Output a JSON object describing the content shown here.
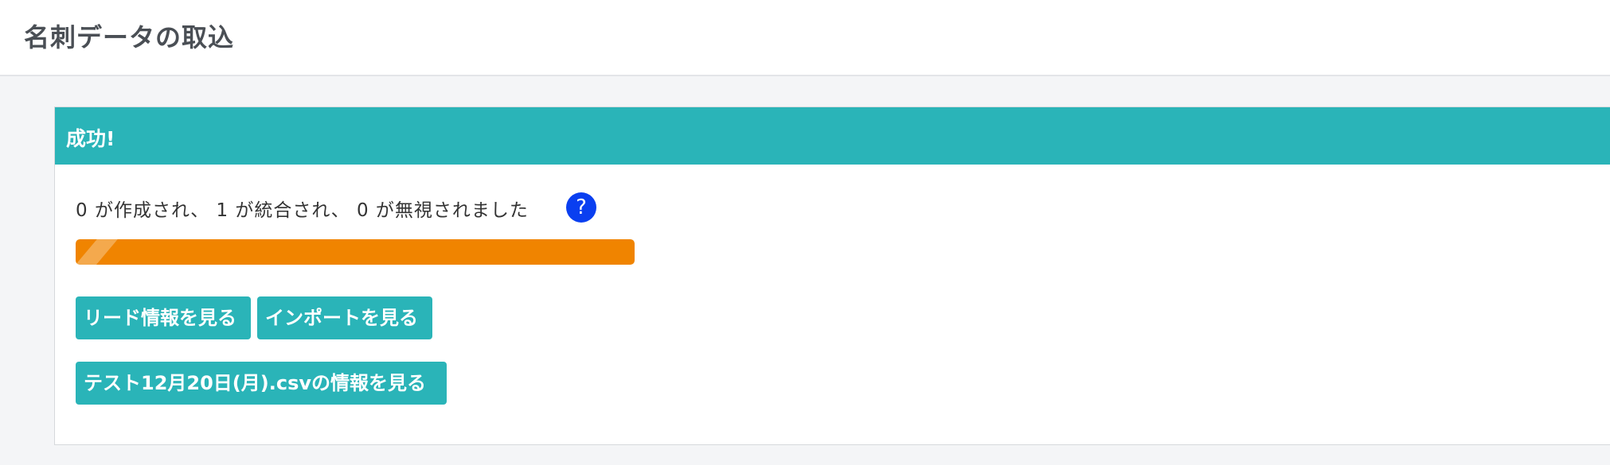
{
  "header": {
    "title": "名刺データの取込"
  },
  "panel": {
    "title": "成功!",
    "result_text": "0 が作成され、 1 が統合され、 0 が無視されました",
    "help_icon": "question-circle-icon",
    "help_glyph": "?",
    "progress_percent": 100,
    "buttons": {
      "view_leads": "リード情報を見る",
      "view_imports": "インポートを見る",
      "view_file": "テスト12月20日(月).csvの情報を見る"
    }
  },
  "colors": {
    "accent": "#2ab4b8",
    "progress": "#f08400",
    "help": "#0a3ff0"
  }
}
